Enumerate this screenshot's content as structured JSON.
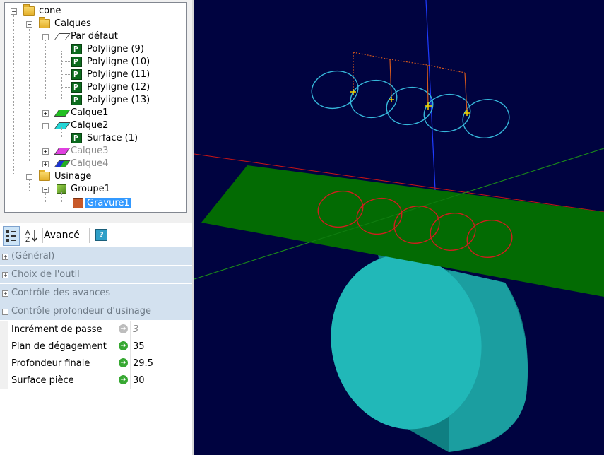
{
  "tree": {
    "root": "cone",
    "calques": "Calques",
    "par_defaut": "Par défaut",
    "polylines": [
      "Polyligne (9)",
      "Polyligne (10)",
      "Polyligne (11)",
      "Polyligne (12)",
      "Polyligne (13)"
    ],
    "calque1": "Calque1",
    "calque2": "Calque2",
    "surface": "Surface (1)",
    "calque3": "Calque3",
    "calque4": "Calque4",
    "usinage": "Usinage",
    "groupe1": "Groupe1",
    "gravure1": "Gravure1"
  },
  "toolbar": {
    "advanced_label": "Avancé",
    "help_label": "?"
  },
  "properties": {
    "categories": [
      "(Général)",
      "Choix de l'outil",
      "Contrôle des avances",
      "Contrôle profondeur d'usinage"
    ],
    "rows": [
      {
        "name": "Incrément de passe",
        "value": "3"
      },
      {
        "name": "Plan de dégagement",
        "value": "35"
      },
      {
        "name": "Profondeur finale",
        "value": "29.5"
      },
      {
        "name": "Surface pièce",
        "value": "30"
      }
    ]
  },
  "colors": {
    "viewport_bg": "#000340",
    "plane": "#006600",
    "cylinder": "#1fa6a6",
    "toolpath": "#cc2222",
    "polyline": "#33b5d6",
    "selection": "#3399ff"
  }
}
